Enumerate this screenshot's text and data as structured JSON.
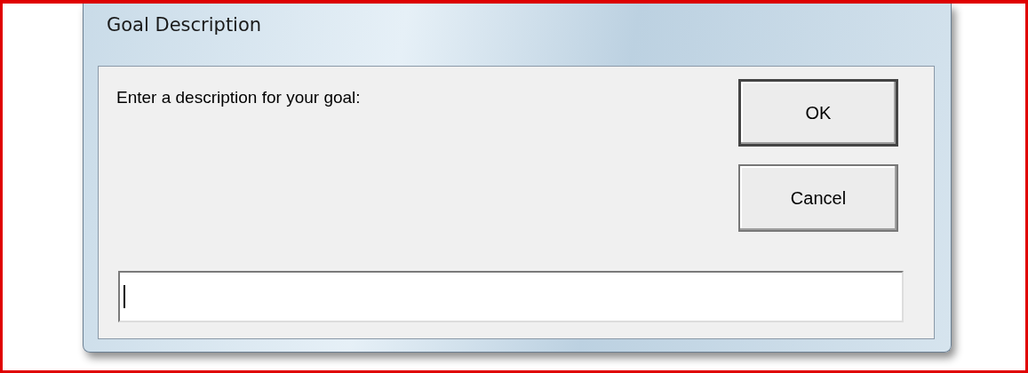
{
  "window": {
    "title": "Goal Description"
  },
  "prompt": "Enter a description for your goal:",
  "buttons": [
    {
      "label": "OK",
      "default": true
    },
    {
      "label": "Cancel",
      "default": false
    }
  ],
  "input": {
    "focused": true
  }
}
